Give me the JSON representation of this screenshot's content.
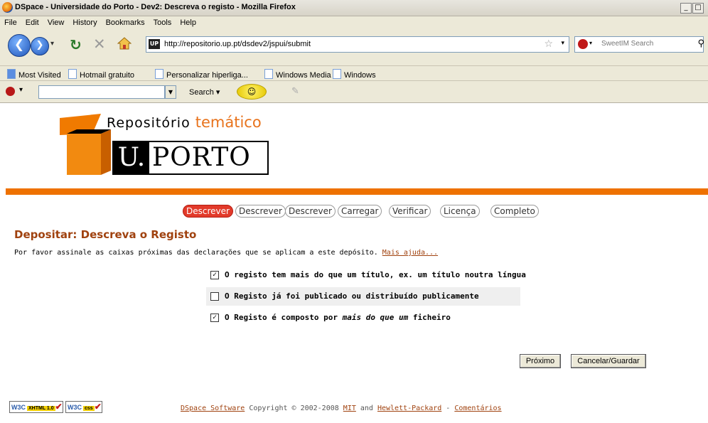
{
  "window": {
    "title": "DSpace - Universidade do Porto - Dev2: Descreva o registo - Mozilla Firefox",
    "buttons": [
      "_",
      "□"
    ]
  },
  "menu": [
    "File",
    "Edit",
    "View",
    "History",
    "Bookmarks",
    "Tools",
    "Help"
  ],
  "navbar": {
    "url": "http://repositorio.up.pt/dsdev2/jspui/submit",
    "favicon_text": "UP",
    "search_placeholder": "SweetIM Search",
    "icons": [
      "back-icon",
      "forward-icon",
      "reload-icon",
      "stop-icon",
      "home-icon",
      "star-icon",
      "search-icon"
    ]
  },
  "bookmarks": [
    "Most Visited",
    "Hotmail gratuito",
    "Personalizar hiperliga...",
    "Windows Media",
    "Windows"
  ],
  "addon_toolbar": {
    "search_label": "Search"
  },
  "logo": {
    "repo_text": "Repositório",
    "tematico_text": "temático",
    "u_text": "U.",
    "porto_text": "PORTO"
  },
  "progress_steps": [
    {
      "label": "Descrever",
      "active": true
    },
    {
      "label": "Descrever",
      "active": false
    },
    {
      "label": "Descrever",
      "active": false
    },
    {
      "label": "Carregar",
      "active": false
    },
    {
      "label": "Verificar",
      "active": false
    },
    {
      "label": "Licença",
      "active": false
    },
    {
      "label": "Completo",
      "active": false
    }
  ],
  "heading": "Depositar: Descreva o Registo",
  "instructions": {
    "text": "Por favor assinale as caixas próximas das declarações que se aplicam a este depósito.",
    "help_link": "Mais ajuda..."
  },
  "checkboxes": [
    {
      "label": "O registo tem mais do que um título, ex. um título noutra língua",
      "checked": true
    },
    {
      "label": "O Registo já foi publicado ou distribuído publicamente",
      "checked": false
    },
    {
      "label_before": "O Registo é composto por ",
      "label_em": "mais do que um",
      "label_after": " ficheiro",
      "checked": true
    }
  ],
  "buttons": {
    "next": "Próximo",
    "cancel_save": "Cancelar/Guardar"
  },
  "badges": {
    "xhtml": {
      "w3c": "W3C",
      "tag": "XHTML 1.0"
    },
    "css": {
      "w3c": "W3C",
      "tag": "css"
    }
  },
  "footer": {
    "dspace_link": "DSpace Software",
    "copyright": " Copyright © 2002-2008 ",
    "mit_link": "MIT",
    "and": " and ",
    "hp_link": "Hewlett-Packard",
    "dash": " - ",
    "comments_link": "Comentários"
  },
  "colors": {
    "accent_orange": "#ee7100",
    "heading_brown": "#a0420f",
    "active_step_red": "#e23a2a"
  }
}
